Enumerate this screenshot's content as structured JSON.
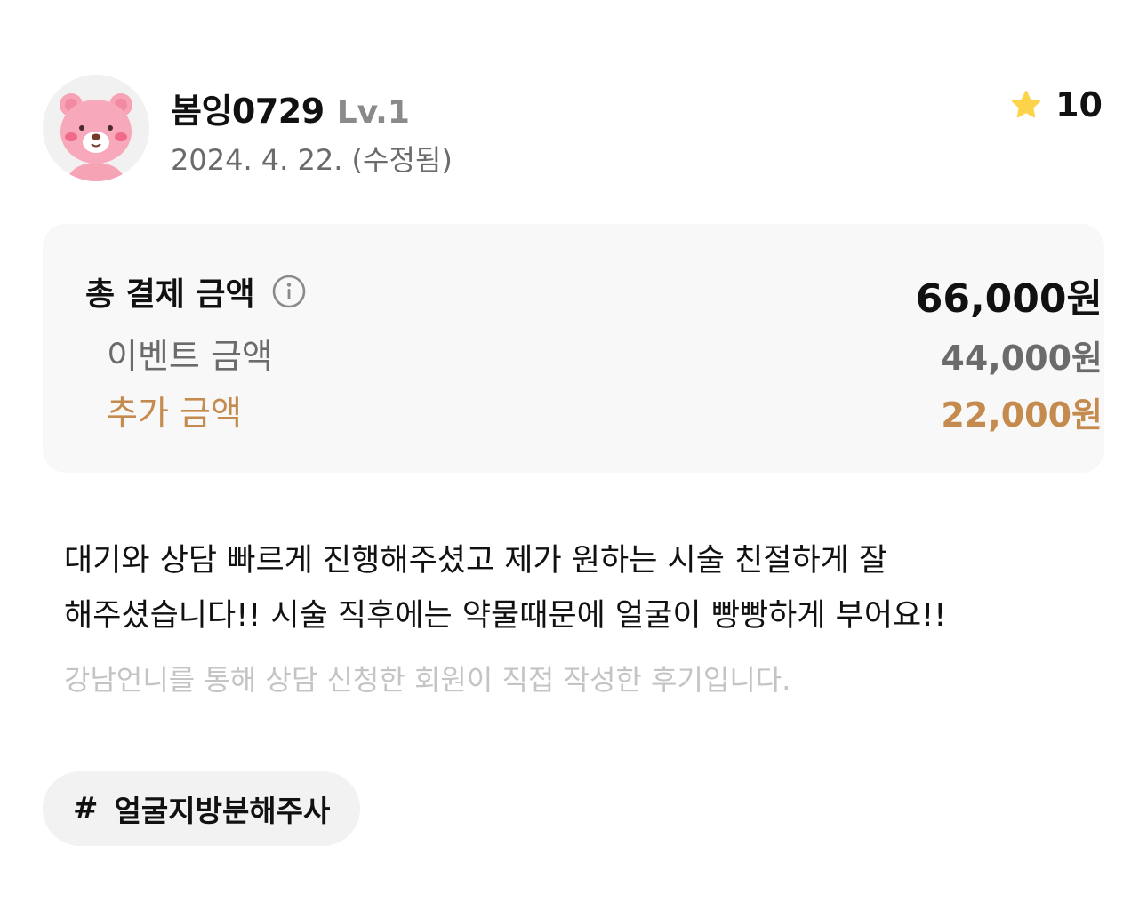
{
  "profile": {
    "avatar_icon": "pink-bear-avatar",
    "nickname": "봄잉0729",
    "level": "Lv.1",
    "date": "2024. 4. 22. (수정됨)"
  },
  "rating": {
    "icon": "star-icon",
    "value": "10",
    "star_color": "#fdd34a"
  },
  "payment": {
    "total_label": "총 결제 금액",
    "total_value": "66,000원",
    "event_label": "이벤트 금액",
    "event_value": "44,000원",
    "extra_label": "추가 금액",
    "extra_value": "22,000원",
    "accent_color": "#c58a4e"
  },
  "review": {
    "lines": [
      "대기와 상담 빠르게 진행해주셨고 제가 원하는 시술 친절하게 잘",
      "해주셨습니다!! 시술 직후에는 약물때문에 얼굴이 빵빵하게 부어요!!"
    ],
    "notice": "강남언니를 통해 상담 신청한 회원이 직접 작성한 후기입니다."
  },
  "tags": [
    {
      "hash": "#",
      "label": "얼굴지방분해주사"
    }
  ]
}
